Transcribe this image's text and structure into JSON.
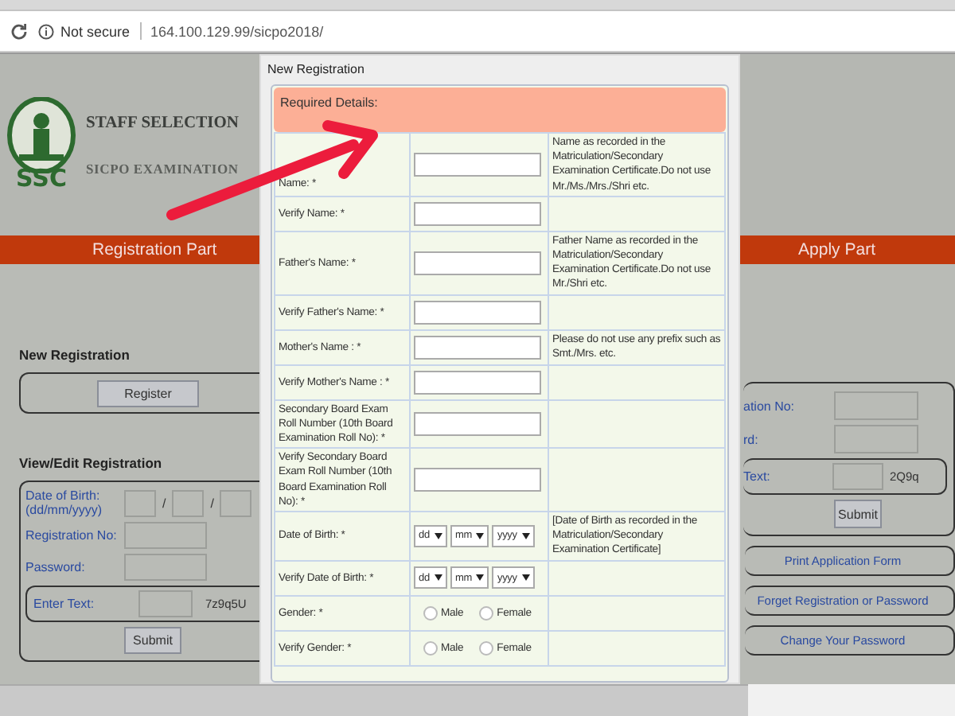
{
  "browser": {
    "status": "Not secure",
    "url": "164.100.129.99/sicpo2018/"
  },
  "header": {
    "logo_text": "SSC",
    "title": "STAFF SELECTION",
    "subtitle": "SICPO EXAMINATION"
  },
  "registration_part": {
    "heading": "Registration Part",
    "new_registration": {
      "heading": "New Registration",
      "button": "Register"
    },
    "view_edit": {
      "heading": "View/Edit Registration",
      "dob_label": "Date of Birth: (dd/mm/yyyy)",
      "separators": [
        "/",
        "/"
      ],
      "registration_label": "Registration No:",
      "password_label": "Password:",
      "captcha_label": "Enter Text:",
      "captcha_code": "7z9q5U",
      "button": "Submit"
    }
  },
  "apply_part": {
    "heading": "Apply Part",
    "fields": [
      {
        "label": "ation No:"
      },
      {
        "label": "rd:"
      }
    ],
    "captcha_label": "Text:",
    "captcha_code": "2Q9q",
    "button": "Submit",
    "links": [
      "Print Application Form",
      "Forget Registration or Password",
      "Change Your Password"
    ]
  },
  "modal": {
    "title": "New Registration",
    "section": "Required Details:",
    "rows": [
      {
        "kind": "text",
        "label": "Name: *",
        "note": "Name as recorded in the Matriculation/Secondary Examination Certificate.Do not use Mr./Ms./Mrs./Shri etc."
      },
      {
        "kind": "text",
        "label": "Verify Name: *"
      },
      {
        "kind": "text",
        "label": "Father's Name: *",
        "note": "Father Name as recorded in the Matriculation/Secondary Examination Certificate.Do not use Mr./Shri etc."
      },
      {
        "kind": "text",
        "label": "Verify Father's Name: *"
      },
      {
        "kind": "text",
        "label": "Mother's Name : *",
        "note": "Please do not use any prefix such as Smt./Mrs. etc."
      },
      {
        "kind": "text",
        "label": "Verify Mother's Name : *"
      },
      {
        "kind": "text",
        "label": "Secondary Board Exam Roll Number (10th Board Examination Roll No): *"
      },
      {
        "kind": "text",
        "label": "Verify Secondary Board Exam Roll Number (10th Board Examination Roll No): *"
      },
      {
        "kind": "date",
        "label": "Date of Birth: *",
        "parts": [
          "dd",
          "mm",
          "yyyy"
        ],
        "note": "[Date of Birth as recorded in the Matriculation/Secondary Examination Certificate]"
      },
      {
        "kind": "date",
        "label": "Verify Date of Birth: *",
        "parts": [
          "dd",
          "mm",
          "yyyy"
        ]
      },
      {
        "kind": "radio",
        "label": "Gender: *",
        "options": [
          {
            "label": "Male",
            "selected": false
          },
          {
            "label": "Female",
            "selected": false
          }
        ]
      },
      {
        "kind": "radio",
        "label": "Verify Gender: *",
        "options": [
          {
            "label": "Male",
            "selected": false
          },
          {
            "label": "Female",
            "selected": false
          }
        ]
      }
    ]
  }
}
